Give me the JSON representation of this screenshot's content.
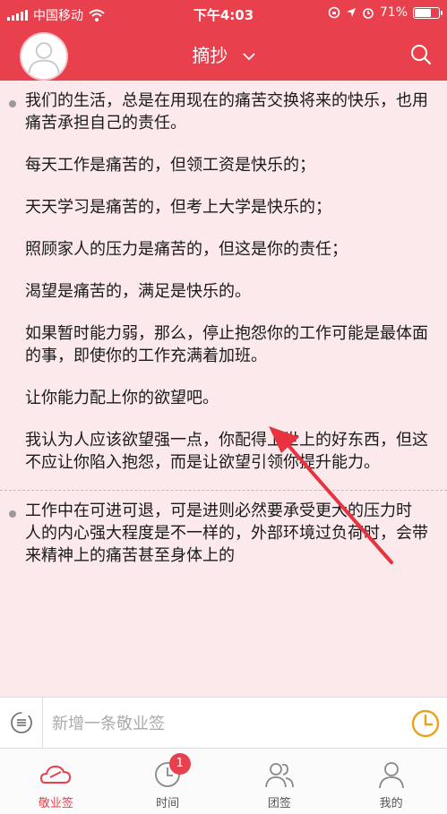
{
  "status_bar": {
    "carrier": "中国移动",
    "time": "下午4:03",
    "battery": "71%",
    "battery_level": 0.71
  },
  "header": {
    "title": "摘抄"
  },
  "entries": [
    {
      "paragraphs": [
        "我们的生活，总是在用现在的痛苦交换将来的快乐，也用痛苦承担自己的责任。",
        "每天工作是痛苦的，但领工资是快乐的；",
        "天天学习是痛苦的，但考上大学是快乐的；",
        "照顾家人的压力是痛苦的，但这是你的责任；",
        "渴望是痛苦的，满足是快乐的。",
        "如果暂时能力弱，那么，停止抱怨你的工作可能是最体面的事，即使你的工作充满着加班。",
        "让你能力配上你的欲望吧。",
        "我认为人应该欲望强一点，你配得上世上的好东西，但这不应让你陷入抱怨，而是让欲望引领你提升能力。"
      ]
    },
    {
      "paragraphs": [
        "工作中在可进可退，可是进则必然要承受更大的压力时",
        "人的内心强大程度是不一样的，外部环境过负荷时，会带来精神上的痛苦甚至身体上的"
      ]
    }
  ],
  "input_bar": {
    "placeholder": "新增一条敬业签"
  },
  "tabs": [
    {
      "label": "敬业签",
      "icon": "cloud-icon",
      "active": true
    },
    {
      "label": "时间",
      "icon": "clock-icon",
      "badge": "1"
    },
    {
      "label": "团签",
      "icon": "group-icon"
    },
    {
      "label": "我的",
      "icon": "person-icon"
    }
  ],
  "colors": {
    "accent": "#e8404d",
    "content_bg": "#fbe9ec",
    "clock_icon": "#e9a21f"
  }
}
